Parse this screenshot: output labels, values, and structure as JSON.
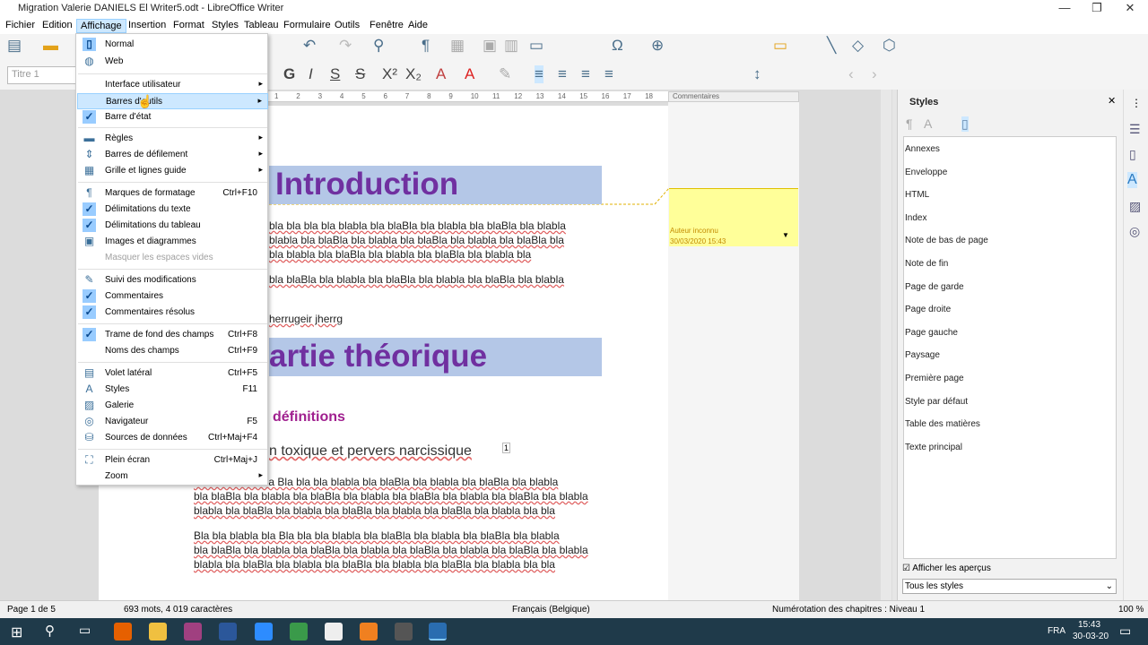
{
  "window": {
    "title": "Migration Valerie DANIELS El Writer5.odt - LibreOffice Writer",
    "min": "—",
    "max": "❐",
    "close": "✕"
  },
  "menubar": [
    "Fichier",
    "Edition",
    "Affichage",
    "Insertion",
    "Format",
    "Styles",
    "Tableau",
    "Formulaire",
    "Outils",
    "Fenêtre",
    "Aide"
  ],
  "toolbar": {
    "para_style": "Titre 1"
  },
  "ruler": {
    "labels": [
      "1",
      "2",
      "3",
      "4",
      "5",
      "6",
      "7",
      "8",
      "9",
      "10",
      "11",
      "12",
      "13",
      "14",
      "15",
      "16",
      "17",
      "18"
    ]
  },
  "comments_header": "Commentaires",
  "comment": {
    "author": "Auteur inconnu",
    "date": "30/03/2020 15:43"
  },
  "document": {
    "heading1": "Introduction",
    "para1": [
      "bla bla bla bla blabla bla blaBla bla blabla bla blaBla bla blabla",
      "blabla bla blaBla bla blabla bla blaBla bla blabla bla blaBla bla",
      "bla blabla bla blaBla bla blabla bla blaBla bla blabla bla"
    ],
    "para2": "bla blaBla bla blabla bla blaBla bla blabla bla blaBla bla blabla",
    "line3": "herrugeir jherrg",
    "heading2": "artie théorique",
    "heading3": "définitions",
    "heading4": "n toxique et pervers  narcissique",
    "footnote": "1",
    "para3": [
      "bla bla blabla bla Bla bla bla blabla bla blaBla bla blabla bla blaBla bla blabla",
      "bla blaBla bla blabla bla blaBla bla blabla bla blaBla bla blabla bla blaBla bla blabla",
      "blabla bla blaBla bla blabla bla blaBla bla blabla bla blaBla bla blabla bla bla"
    ],
    "para4": [
      "Bla bla blabla bla Bla bla bla blabla bla blaBla bla blabla bla blaBla bla blabla",
      "bla blaBla bla blabla bla blaBla bla blabla bla blaBla bla blabla bla blaBla bla blabla",
      "blabla bla blaBla bla blabla bla blaBla bla blabla bla blaBla bla blabla bla bla"
    ]
  },
  "view_menu": {
    "items": [
      {
        "label": "Normal",
        "icon": "▯",
        "checked": true
      },
      {
        "label": "Web",
        "icon": "◍"
      },
      {
        "sep": true
      },
      {
        "label": "Interface utilisateur",
        "sub": true
      },
      {
        "label": "Barres d'outils",
        "sub": true,
        "hi": true
      },
      {
        "label": "Barre d'état",
        "check": true
      },
      {
        "sep": true
      },
      {
        "label": "Règles",
        "icon": "▬",
        "sub": true
      },
      {
        "label": "Barres de défilement",
        "icon": "⇕",
        "sub": true
      },
      {
        "label": "Grille et lignes guide",
        "icon": "▦",
        "sub": true
      },
      {
        "sep": true
      },
      {
        "label": "Marques de formatage",
        "icon": "¶",
        "shortcut": "Ctrl+F10"
      },
      {
        "label": "Délimitations du texte",
        "check": true
      },
      {
        "label": "Délimitations du tableau",
        "check": true
      },
      {
        "label": "Images et diagrammes",
        "icon": "▣"
      },
      {
        "label": "Masquer les espaces vides",
        "disabled": true
      },
      {
        "sep": true
      },
      {
        "label": "Suivi des modifications",
        "icon": "✎"
      },
      {
        "label": "Commentaires",
        "check": true
      },
      {
        "label": "Commentaires résolus",
        "check": true
      },
      {
        "sep": true
      },
      {
        "label": "Trame de fond des champs",
        "check": true,
        "shortcut": "Ctrl+F8"
      },
      {
        "label": "Noms des champs",
        "shortcut": "Ctrl+F9"
      },
      {
        "sep": true
      },
      {
        "label": "Volet latéral",
        "icon": "▤",
        "shortcut": "Ctrl+F5"
      },
      {
        "label": "Styles",
        "icon": "A",
        "shortcut": "F11"
      },
      {
        "label": "Galerie",
        "icon": "▨"
      },
      {
        "label": "Navigateur",
        "icon": "◎",
        "shortcut": "F5"
      },
      {
        "label": "Sources de données",
        "icon": "⛁",
        "shortcut": "Ctrl+Maj+F4"
      },
      {
        "sep": true
      },
      {
        "label": "Plein écran",
        "icon": "⛶",
        "shortcut": "Ctrl+Maj+J"
      },
      {
        "label": "Zoom",
        "sub": true
      }
    ]
  },
  "sidebar": {
    "title": "Styles",
    "styles": [
      "Annexes",
      "Enveloppe",
      "HTML",
      "Index",
      "Note de bas de page",
      "Note de fin",
      "Page de garde",
      "Page droite",
      "Page gauche",
      "Paysage",
      "Première page",
      "Style par défaut",
      "Table des matières",
      "Texte principal"
    ],
    "show_preview": "Afficher les aperçus",
    "filter": "Tous les styles"
  },
  "statusbar": {
    "page": "Page 1 de 5",
    "words": "693 mots, 4 019 caractères",
    "lang": "Français (Belgique)",
    "outline": "Numérotation des chapitres : Niveau 1",
    "zoom": "100 %"
  },
  "taskbar": {
    "lang": "FRA",
    "time": "15:43",
    "date": "30-03-20"
  }
}
